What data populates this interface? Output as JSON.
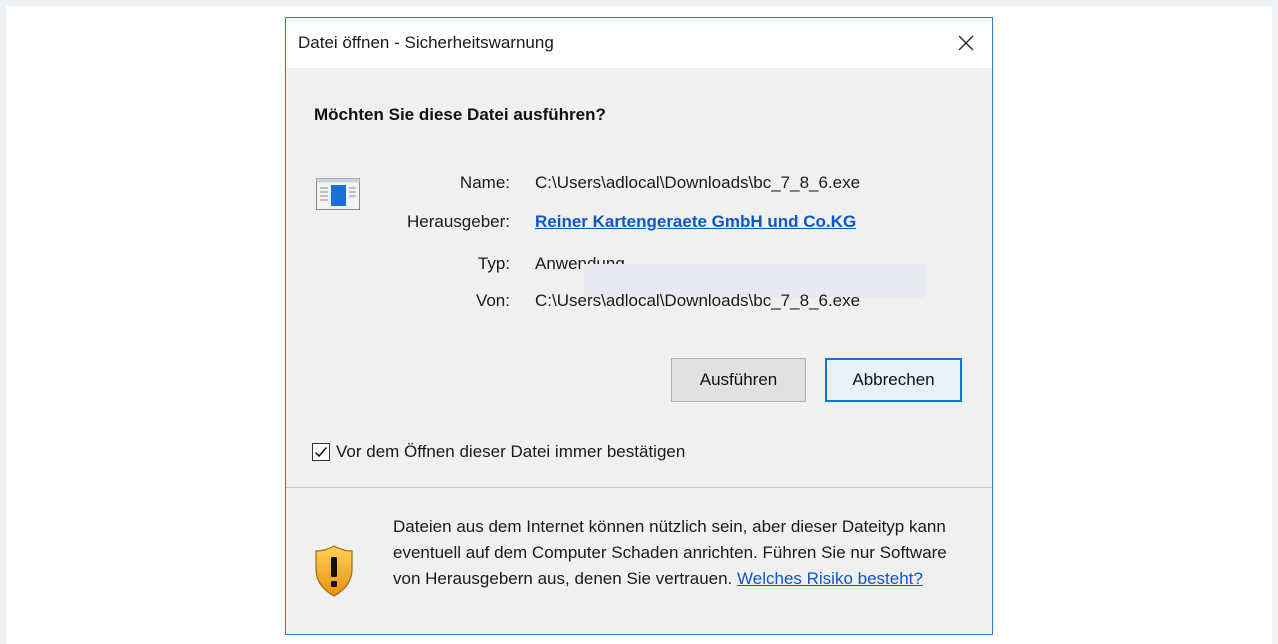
{
  "dialog": {
    "title": "Datei öffnen - Sicherheitswarnung",
    "heading": "Möchten Sie diese Datei ausführen?",
    "properties": [
      {
        "label": "Name:",
        "value": "C:\\Users\\adlocal\\Downloads\\bc_7_8_6.exe"
      },
      {
        "label": "Herausgeber:",
        "value": "Reiner Kartengeraete GmbH und Co.KG"
      },
      {
        "label": "Typ:",
        "value": "Anwendung"
      },
      {
        "label": "Von:",
        "value": "C:\\Users\\adlocal\\Downloads\\bc_7_8_6.exe"
      }
    ],
    "buttons": {
      "run": "Ausführen",
      "cancel": "Abbrechen"
    },
    "checkbox": {
      "label": "Vor dem Öffnen dieser Datei immer bestätigen",
      "checked": true
    },
    "warning": {
      "text": "Dateien aus dem Internet können nützlich sein, aber dieser Dateityp kann eventuell auf dem Computer Schaden anrichten. Führen Sie nur Software von Herausgebern aus, denen Sie vertrauen.",
      "link": "Welches Risiko besteht?"
    },
    "icons": [
      "application-icon",
      "close-icon",
      "checkmark-icon",
      "shield-warning-icon"
    ],
    "colors": {
      "accent": "#0a78d4",
      "link": "#0b57c8",
      "border": "#2f7dd1",
      "shield": "#f5a623"
    }
  }
}
